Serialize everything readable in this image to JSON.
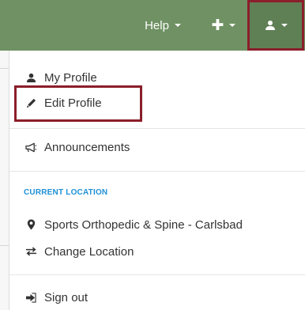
{
  "navbar": {
    "help_label": "Help",
    "plus_icon": "plus-icon",
    "user_icon": "user-icon",
    "bg_color": "#6f9163",
    "highlight_color": "#8b1e2b"
  },
  "menu": {
    "my_profile": "My Profile",
    "edit_profile": "Edit Profile",
    "announcements": "Announcements",
    "current_location_header": "CURRENT LOCATION",
    "location_name": "Sports Orthopedic & Spine - Carlsbad",
    "change_location": "Change Location",
    "sign_out": "Sign out"
  },
  "colors": {
    "text": "#333333",
    "section_header": "#1e90d6",
    "divider": "#e5e5e5"
  }
}
